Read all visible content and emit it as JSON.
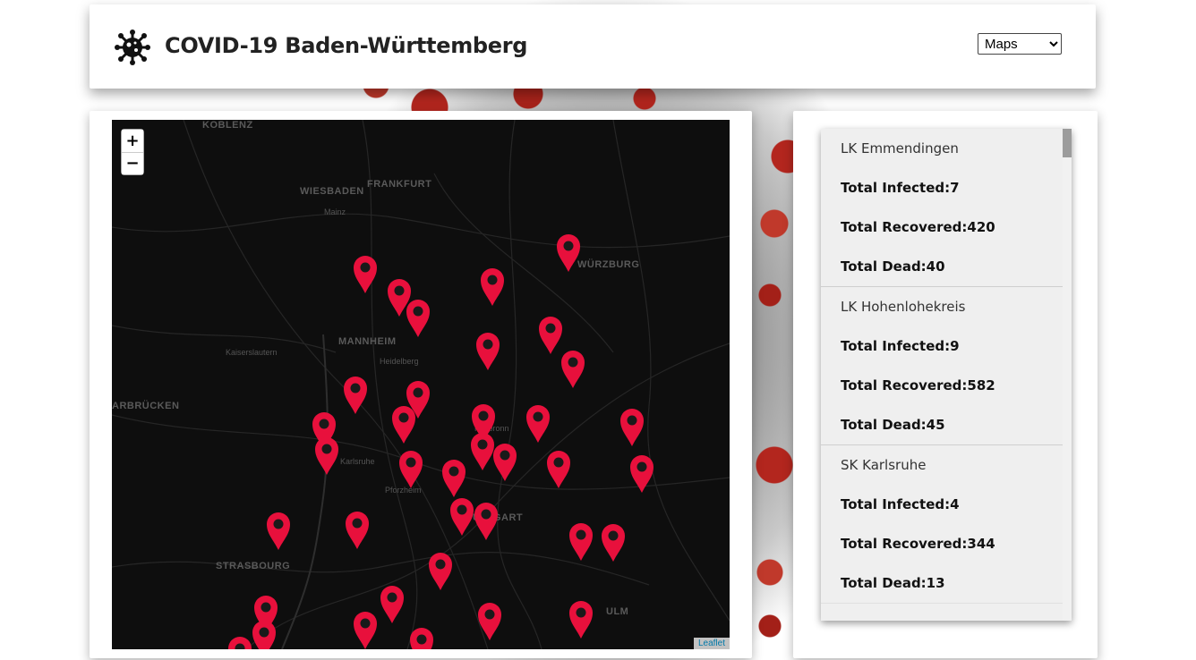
{
  "header": {
    "title": "COVID-19 Baden-Württemberg",
    "logo_icon": "virus-icon",
    "view_select": {
      "selected": "Maps",
      "options": [
        "Maps"
      ]
    }
  },
  "map": {
    "zoom_in_label": "+",
    "zoom_out_label": "−",
    "attribution": "Leaflet",
    "marker_color": "#e8103c",
    "labels": [
      "KOBLENZ",
      "WIESBADEN",
      "FRANKFURT",
      "Mainz",
      "WÜRZBURG",
      "MANNHEIM",
      "Kaiserslautern",
      "Heidelberg",
      "ARBRÜCKEN",
      "Heilbronn",
      "Karlsruhe",
      "Pforzheim",
      "STUTTGART",
      "STRASBOURG",
      "ULM"
    ]
  },
  "districts": [
    {
      "name": "LK Emmendingen",
      "infected": "Total Infected:7",
      "recovered": "Total Recovered:420",
      "dead": "Total Dead:40"
    },
    {
      "name": "LK Hohenlohekreis",
      "infected": "Total Infected:9",
      "recovered": "Total Recovered:582",
      "dead": "Total Dead:45"
    },
    {
      "name": "SK Karlsruhe",
      "infected": "Total Infected:4",
      "recovered": "Total Recovered:344",
      "dead": "Total Dead:13"
    }
  ]
}
